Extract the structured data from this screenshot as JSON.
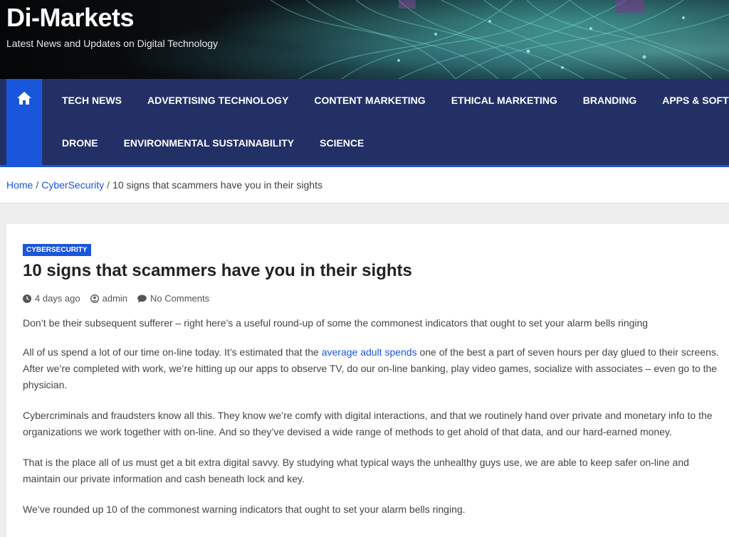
{
  "site": {
    "title": "Di-Markets",
    "tagline": "Latest News and Updates on Digital Technology"
  },
  "nav": {
    "home_icon": "home-icon",
    "row1": [
      "TECH NEWS",
      "ADVERTISING TECHNOLOGY",
      "CONTENT MARKETING",
      "ETHICAL MARKETING",
      "BRANDING",
      "APPS & SOFTWARE"
    ],
    "row2": [
      "DRONE",
      "ENVIRONMENTAL SUSTAINABILITY",
      "SCIENCE"
    ]
  },
  "breadcrumb": {
    "home": "Home",
    "category": "CyberSecurity",
    "current": "10 signs that scammers have you in their sights",
    "separator": "/"
  },
  "article": {
    "category": "CYBERSECURITY",
    "title": "10 signs that scammers have you in their sights",
    "meta": {
      "date": "4 days ago",
      "author": "admin",
      "comments": "No Comments"
    },
    "p1": "Don’t be their subsequent sufferer – right here’s a useful round-up of some the commonest indicators that ought to set your alarm bells ringing",
    "p2_before": "All of us spend a lot of our time on-line today. It’s estimated that the ",
    "p2_link": "average adult spends",
    "p2_after": " one of the best a part of seven hours per day glued to their screens. After we’re completed with work, we’re hitting up our apps to observe TV, do our on-line banking, play video games, socialize with associates – even go to the physician.",
    "p3": "Cybercriminals and fraudsters know all this. They know we’re comfy with digital interactions, and that we routinely hand over private and monetary info to the organizations we work together with on-line. And so they’ve devised a wide range of methods to get ahold of that data, and our hard-earned money.",
    "p4": "That is the place all of us must get a bit extra digital savvy. By studying what typical ways the unhealthy guys use, we are able to keep safer on-line and maintain our private information and cash beneath lock and key.",
    "p5": "We’ve rounded up 10 of the commonest warning indicators that ought to set your alarm bells ringing."
  },
  "colors": {
    "nav_bg": "#233066",
    "accent": "#1a56db",
    "link": "#1a56db"
  }
}
